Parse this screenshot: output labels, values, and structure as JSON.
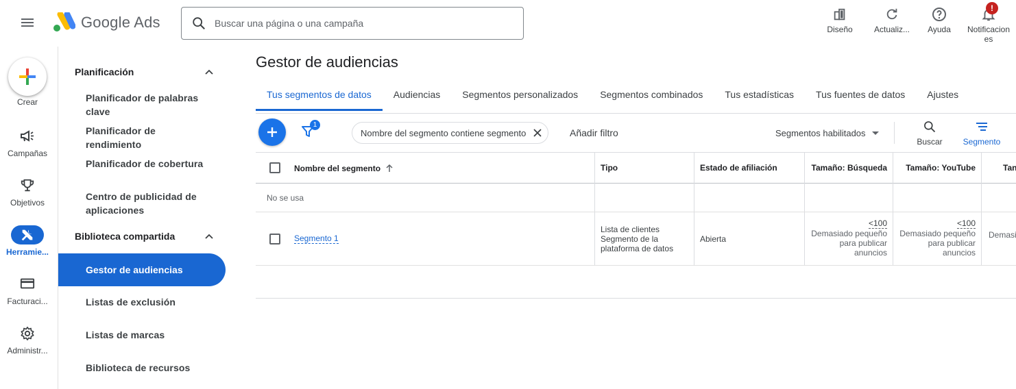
{
  "app": {
    "name": "Google Ads",
    "search_placeholder": "Buscar una página o una campaña"
  },
  "toolbar": {
    "design": "Diseño",
    "refresh": "Actualiz...",
    "help": "Ayuda",
    "notifications_line1": "Notificacion",
    "notifications_line2": "es",
    "notifications_badge": "!"
  },
  "rail": {
    "create": "Crear",
    "campaigns": "Campañas",
    "goals": "Objetivos",
    "tools": "Herramie...",
    "billing": "Facturaci...",
    "admin": "Administr..."
  },
  "subnav": {
    "planning_title": "Planificación",
    "planning_items": [
      "Planificador de palabras clave",
      "Planificador de rendimiento",
      "Planificador de cobertura",
      "Centro de publicidad de aplicaciones"
    ],
    "shared_title": "Biblioteca compartida",
    "shared_items": [
      "Gestor de audiencias",
      "Listas de exclusión",
      "Listas de marcas",
      "Biblioteca de recursos"
    ]
  },
  "page": {
    "title": "Gestor de audiencias",
    "tabs": [
      "Tus segmentos de datos",
      "Audiencias",
      "Segmentos personalizados",
      "Segmentos combinados",
      "Tus estadísticas",
      "Tus fuentes de datos",
      "Ajustes"
    ]
  },
  "table_toolbar": {
    "filter_count": "1",
    "filter_chip": "Nombre del segmento contiene segmento",
    "add_filter": "Añadir filtro",
    "segment_select": "Segmentos habilitados",
    "search_label": "Buscar",
    "segment_label": "Segmento"
  },
  "table": {
    "columns": [
      "Nombre del segmento",
      "Tipo",
      "Estado de afiliación",
      "Tamaño: Búsqueda",
      "Tamaño: YouTube",
      "Tan"
    ],
    "group_label": "No se usa",
    "rows": [
      {
        "name": "Segmento 1",
        "type_line1": "Lista de clientes",
        "type_line2": "Segmento de la",
        "type_line3": "plataforma de datos",
        "status": "Abierta",
        "search_size": "<100",
        "search_note_1": "Demasiado pequeño",
        "search_note_2": "para publicar",
        "search_note_3": "anuncios",
        "youtube_size": "<100",
        "youtube_note_1": "Demasiado pequeño",
        "youtube_note_2": "para publicar",
        "youtube_note_3": "anuncios",
        "next_col_partial": "Demasi"
      }
    ]
  },
  "colors": {
    "primary": "#1967d2",
    "badge_red": "#c5221f"
  }
}
